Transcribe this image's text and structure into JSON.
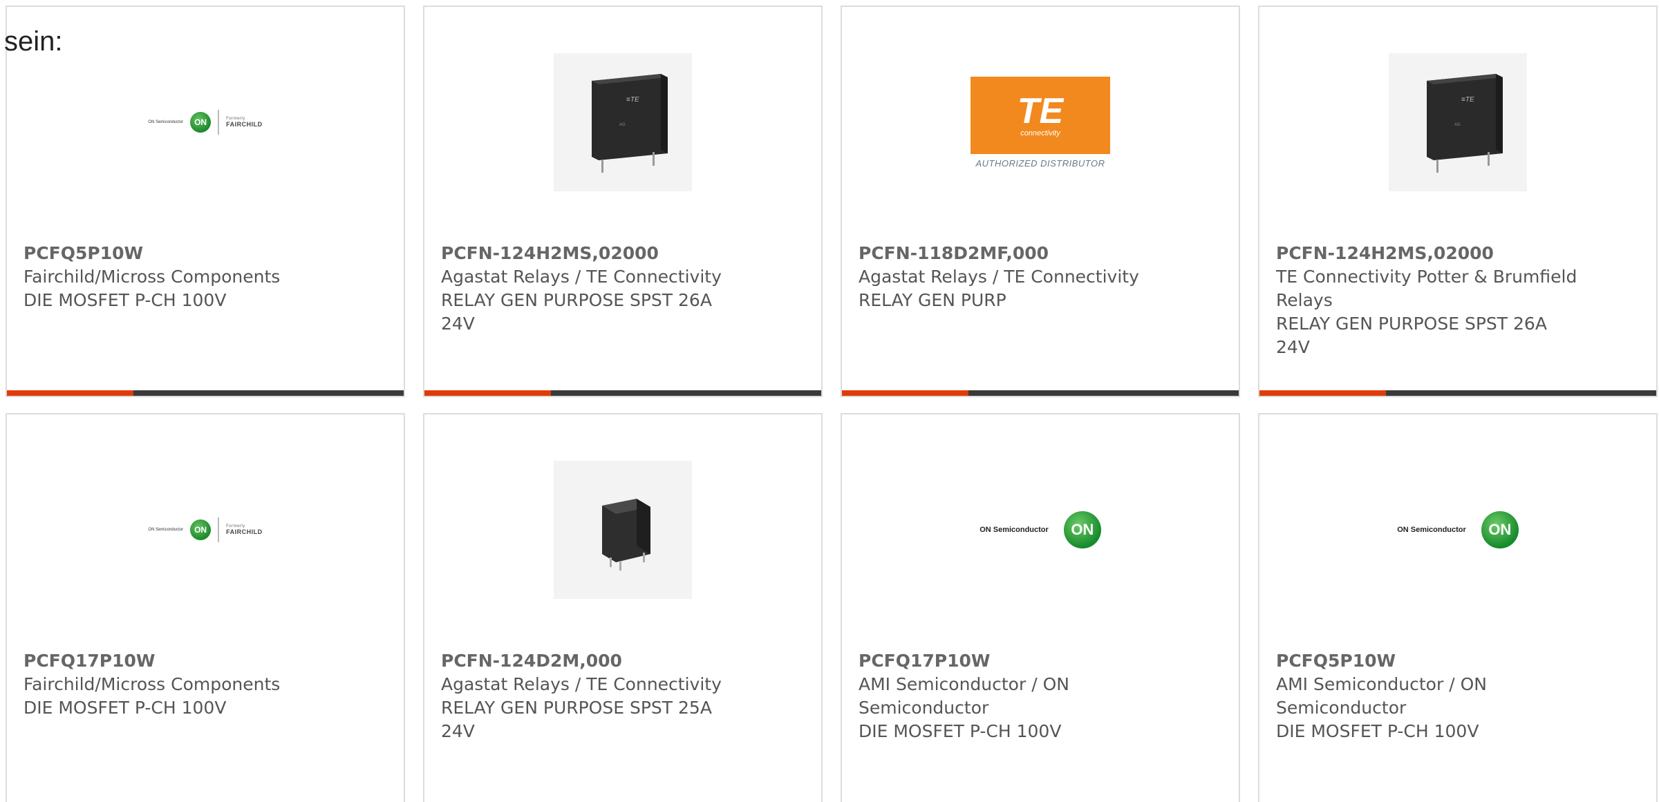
{
  "intro": {
    "text": "sein:"
  },
  "colors": {
    "accent": "#e03c0a",
    "bar_dark": "#3a3a3a",
    "text": "#555555",
    "border": "#dcdcdc"
  },
  "logos": {
    "on_semiconductor": "ON Semiconductor",
    "on_badge": "ON",
    "fairchild_formerly": "Formerly",
    "fairchild_word": "FAIRCHILD",
    "te_letters": "TE",
    "te_sub": "connectivity",
    "te_authorized": "AUTHORIZED DISTRIBUTOR"
  },
  "cards": [
    {
      "image": "fairchild-on-logo",
      "part": "PCFQ5P10W",
      "maker": "Fairchild/Micross Components",
      "desc": "DIE MOSFET P-CH 100V"
    },
    {
      "image": "relay-photo",
      "part": "PCFN-124H2MS,02000",
      "maker": "Agastat Relays / TE Connectivity",
      "desc": "RELAY GEN PURPOSE SPST 26A 24V"
    },
    {
      "image": "te-logo",
      "part": "PCFN-118D2MF,000",
      "maker": "Agastat Relays / TE Connectivity",
      "desc": "RELAY GEN PURP"
    },
    {
      "image": "relay-photo",
      "part": "PCFN-124H2MS,02000",
      "maker": "TE Connectivity Potter & Brumfield Relays",
      "desc": "RELAY GEN PURPOSE SPST 26A 24V"
    },
    {
      "image": "fairchild-on-logo",
      "part": "PCFQ17P10W",
      "maker": "Fairchild/Micross Components",
      "desc": "DIE MOSFET P-CH 100V"
    },
    {
      "image": "relay-photo",
      "part": "PCFN-124D2M,000",
      "maker": "Agastat Relays / TE Connectivity",
      "desc": "RELAY GEN PURPOSE SPST 25A 24V"
    },
    {
      "image": "on-logo",
      "part": "PCFQ17P10W",
      "maker": "AMI Semiconductor / ON Semiconductor",
      "desc": "DIE MOSFET P-CH 100V"
    },
    {
      "image": "on-logo",
      "part": "PCFQ5P10W",
      "maker": "AMI Semiconductor / ON Semiconductor",
      "desc": "DIE MOSFET P-CH 100V"
    }
  ]
}
